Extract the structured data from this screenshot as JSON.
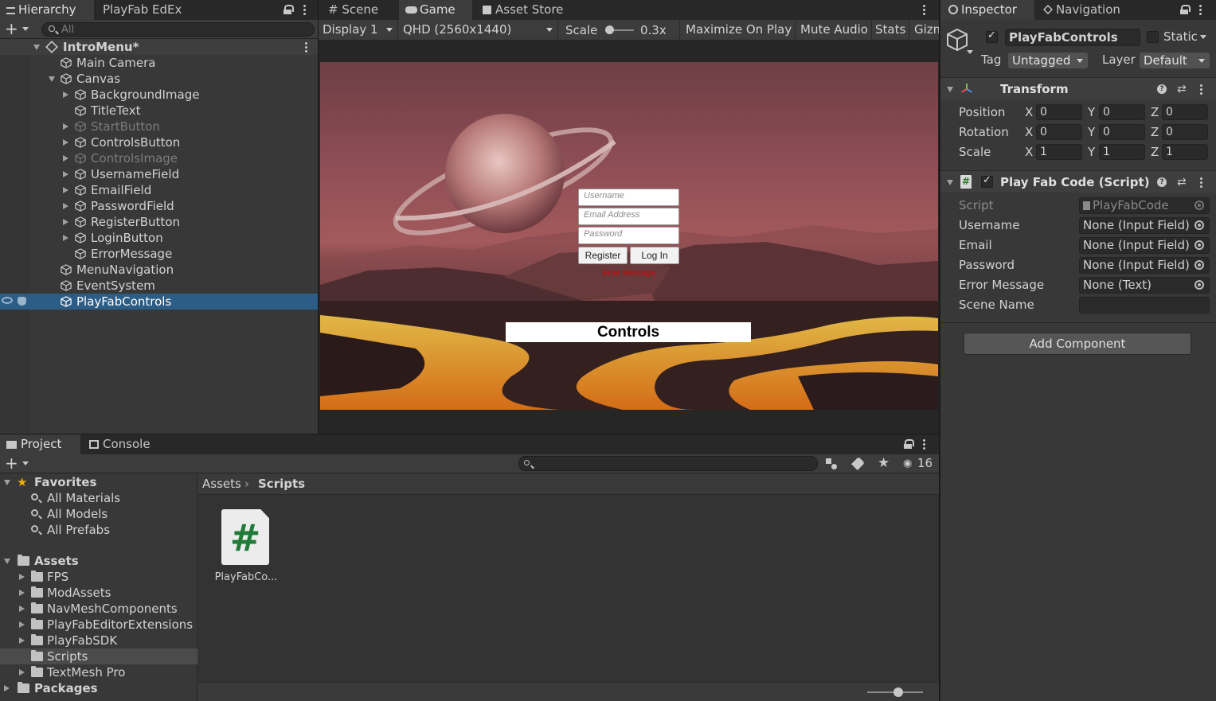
{
  "hierarchy": {
    "tabs": [
      "Hierarchy",
      "PlayFab EdEx"
    ],
    "search_placeholder": "All",
    "scene": "IntroMenu*",
    "items": [
      {
        "label": "Main Camera"
      },
      {
        "label": "Canvas"
      },
      {
        "label": "BackgroundImage"
      },
      {
        "label": "TitleText"
      },
      {
        "label": "StartButton"
      },
      {
        "label": "ControlsButton"
      },
      {
        "label": "ControlsImage"
      },
      {
        "label": "UsernameField"
      },
      {
        "label": "EmailField"
      },
      {
        "label": "PasswordField"
      },
      {
        "label": "RegisterButton"
      },
      {
        "label": "LoginButton"
      },
      {
        "label": "ErrorMessage"
      },
      {
        "label": "MenuNavigation"
      },
      {
        "label": "EventSystem"
      },
      {
        "label": "PlayFabControls"
      }
    ]
  },
  "game": {
    "tabs": [
      "Scene",
      "Game",
      "Asset Store"
    ],
    "display": "Display 1",
    "resolution": "QHD (2560x1440)",
    "scale_label": "Scale",
    "scale_value": "0.3x",
    "buttons": [
      "Maximize On Play",
      "Mute Audio",
      "Stats",
      "Gizm"
    ],
    "ui": {
      "username_placeholder": "Username",
      "email_placeholder": "Email Address",
      "password_placeholder": "Password",
      "register": "Register",
      "login": "Log In",
      "error": "Error Message",
      "controls": "Controls"
    }
  },
  "inspector": {
    "tabs": [
      "Inspector",
      "Navigation"
    ],
    "object_name": "PlayFabControls",
    "static_label": "Static",
    "tag_label": "Tag",
    "tag_value": "Untagged",
    "layer_label": "Layer",
    "layer_value": "Default",
    "transform": {
      "title": "Transform",
      "rows": [
        {
          "label": "Position",
          "x": "0",
          "y": "0",
          "z": "0"
        },
        {
          "label": "Rotation",
          "x": "0",
          "y": "0",
          "z": "0"
        },
        {
          "label": "Scale",
          "x": "1",
          "y": "1",
          "z": "1"
        }
      ],
      "axes": [
        "X",
        "Y",
        "Z"
      ]
    },
    "script": {
      "title": "Play Fab Code (Script)",
      "rows": [
        {
          "label": "Script",
          "value": "PlayFabCode"
        },
        {
          "label": "Username",
          "value": "None (Input Field)"
        },
        {
          "label": "Email",
          "value": "None (Input Field)"
        },
        {
          "label": "Password",
          "value": "None (Input Field)"
        },
        {
          "label": "Error Message",
          "value": "None (Text)"
        },
        {
          "label": "Scene Name",
          "value": ""
        }
      ]
    },
    "add_component": "Add Component"
  },
  "project": {
    "tabs": [
      "Project",
      "Console"
    ],
    "hidden_count": "16",
    "favorites_label": "Favorites",
    "favorites": [
      "All Materials",
      "All Models",
      "All Prefabs"
    ],
    "assets_label": "Assets",
    "folders": [
      "FPS",
      "ModAssets",
      "NavMeshComponents",
      "PlayFabEditorExtensions",
      "PlayFabSDK",
      "Scripts",
      "TextMesh Pro"
    ],
    "packages_label": "Packages",
    "breadcrumb": [
      "Assets",
      "Scripts"
    ],
    "file": "PlayFabCo..."
  },
  "colors": {
    "selection": "#2c5d87",
    "panel": "#383838",
    "error_text": "#d40000"
  }
}
